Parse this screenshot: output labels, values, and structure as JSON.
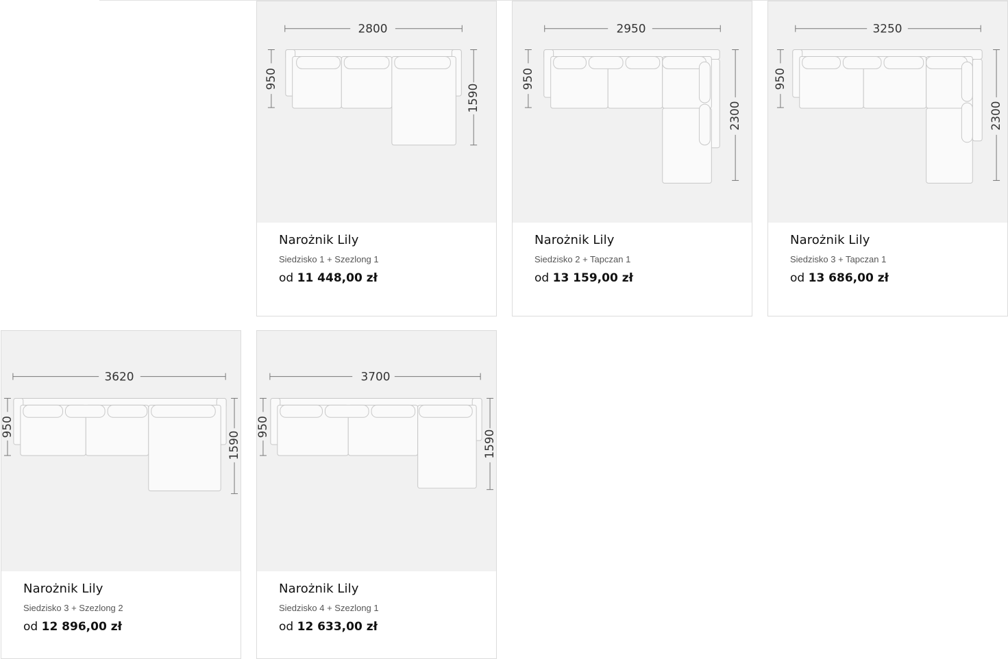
{
  "products": [
    {
      "title": "Narożnik Lily",
      "subtitle": "Siedzisko 1 + Szezlong 1",
      "price_prefix": "od",
      "price": "11 448,00 zł",
      "width": "2800",
      "depth": "950",
      "chaise_depth": "1590",
      "image_icon": "sofa-diagram"
    },
    {
      "title": "Narożnik Lily",
      "subtitle": "Siedzisko 2 + Tapczan 1",
      "price_prefix": "od",
      "price": "13 159,00 zł",
      "width": "2950",
      "depth": "950",
      "chaise_depth": "2300",
      "image_icon": "sofa-diagram"
    },
    {
      "title": "Narożnik Lily",
      "subtitle": "Siedzisko 3 + Tapczan 1",
      "price_prefix": "od",
      "price": "13 686,00 zł",
      "width": "3250",
      "depth": "950",
      "chaise_depth": "2300",
      "image_icon": "sofa-diagram"
    },
    {
      "title": "Narożnik Lily",
      "subtitle": "Siedzisko 3 + Szezlong 2",
      "price_prefix": "od",
      "price": "12 896,00 zł",
      "width": "3620",
      "depth": "950",
      "chaise_depth": "1590",
      "image_icon": "sofa-diagram"
    },
    {
      "title": "Narożnik Lily",
      "subtitle": "Siedzisko 4 + Szezlong 1",
      "price_prefix": "od",
      "price": "12 633,00 zł",
      "width": "3700",
      "depth": "950",
      "chaise_depth": "1590",
      "image_icon": "sofa-diagram"
    }
  ]
}
